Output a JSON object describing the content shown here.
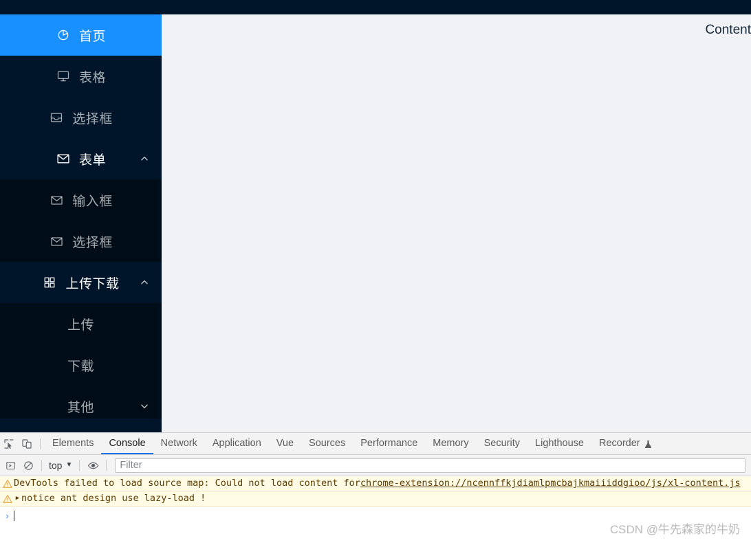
{
  "app": {
    "topbar": {
      "background": "#001529"
    },
    "content": {
      "label": "Content"
    },
    "colors": {
      "sider_bg": "#001529",
      "submenu_bg": "#000c17",
      "active_blue": "#1890ff",
      "content_bg": "#f0f2f5"
    }
  },
  "sidebar": {
    "items": [
      {
        "label": "首页",
        "icon": "pie-chart-icon",
        "level": 1,
        "selected": true,
        "arrow": ""
      },
      {
        "label": "表格",
        "icon": "desktop-icon",
        "level": 1,
        "selected": false,
        "arrow": ""
      },
      {
        "label": "选择框",
        "icon": "inbox-icon",
        "level": 1,
        "selected": false,
        "arrow": ""
      },
      {
        "label": "表单",
        "icon": "mail-icon",
        "level": 1,
        "selected": false,
        "arrow": "up",
        "group": true
      },
      {
        "label": "输入框",
        "icon": "mail-icon",
        "level": 2,
        "selected": false,
        "arrow": ""
      },
      {
        "label": "选择框",
        "icon": "mail-icon",
        "level": 2,
        "selected": false,
        "arrow": ""
      },
      {
        "label": "上传下载",
        "icon": "appstore-icon",
        "level": 1,
        "selected": false,
        "arrow": "up",
        "group": true
      },
      {
        "label": "上传",
        "icon": "",
        "level": 2,
        "selected": false,
        "arrow": ""
      },
      {
        "label": "下载",
        "icon": "",
        "level": 2,
        "selected": false,
        "arrow": ""
      },
      {
        "label": "其他",
        "icon": "",
        "level": 2,
        "selected": false,
        "arrow": "down"
      }
    ]
  },
  "devtools": {
    "tabs": [
      {
        "label": "Elements",
        "active": false,
        "experimental": false
      },
      {
        "label": "Console",
        "active": true,
        "experimental": false
      },
      {
        "label": "Network",
        "active": false,
        "experimental": false
      },
      {
        "label": "Application",
        "active": false,
        "experimental": false
      },
      {
        "label": "Vue",
        "active": false,
        "experimental": false
      },
      {
        "label": "Sources",
        "active": false,
        "experimental": false
      },
      {
        "label": "Performance",
        "active": false,
        "experimental": false
      },
      {
        "label": "Memory",
        "active": false,
        "experimental": false
      },
      {
        "label": "Security",
        "active": false,
        "experimental": false
      },
      {
        "label": "Lighthouse",
        "active": false,
        "experimental": false
      },
      {
        "label": "Recorder",
        "active": false,
        "experimental": true
      }
    ],
    "toolbar": {
      "inspect_icon": "inspect-element-icon",
      "device_icon": "device-toolbar-icon"
    },
    "filterbar": {
      "execute_icon": "execute-sidebar-icon",
      "clear_icon": "clear-console-icon",
      "context": "top",
      "context_caret": "▼",
      "eye_icon": "live-expression-eye-icon",
      "filter_placeholder": "Filter",
      "filter_value": ""
    },
    "console": {
      "messages": [
        {
          "level": "warning",
          "expandable": false,
          "text_before": "DevTools failed to load source map: Could not load content for ",
          "link": "chrome-extension://ncennffkjdiamlpmcbajkmaiiiddgioo/js/xl-content.js",
          "text_after": ""
        },
        {
          "level": "warning",
          "expandable": true,
          "disclosure": "▶",
          "text_before": "notice ant design use lazy-load !",
          "link": "",
          "text_after": ""
        }
      ],
      "prompt_arrow": "›"
    }
  },
  "watermark": {
    "text": "CSDN @牛先森家的牛奶"
  }
}
